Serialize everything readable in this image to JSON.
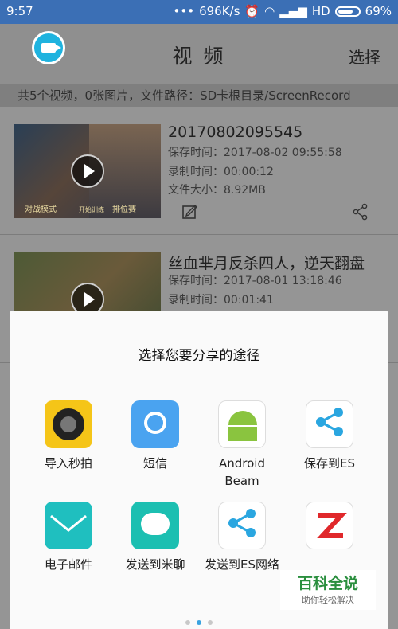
{
  "status": {
    "time": "9:57",
    "speed": "696K/s",
    "network": "HD",
    "battery": "69%"
  },
  "header": {
    "title": "视 频",
    "select_label": "选择"
  },
  "info_bar": "共5个视频，0张图片，文件路径：SD卡根目录/ScreenRecord",
  "videos": [
    {
      "name": "20170802095545",
      "save_time": "保存时间：2017-08-02 09:55:58",
      "record_time": "录制时间：00:00:12",
      "file_size": "文件大小：8.92MB",
      "thumb_left": "对战模式",
      "thumb_mid": "开始训练",
      "thumb_right": "排位赛"
    },
    {
      "name": "丝血芈月反杀四人，逆天翻盘",
      "save_time": "保存时间：2017-08-01 13:18:46",
      "record_time": "录制时间：00:01:41"
    }
  ],
  "share": {
    "title": "选择您要分享的途径",
    "options": [
      {
        "label": "导入秒拍",
        "icon": "miaopai-icon",
        "color": "#f5c518"
      },
      {
        "label": "短信",
        "icon": "sms-icon",
        "color": "#4aa3f0"
      },
      {
        "label": "Android\nBeam",
        "icon": "android-beam-icon",
        "color": "#8ac43f"
      },
      {
        "label": "保存到ES",
        "icon": "es-share-icon",
        "color": "#2aa6e0"
      },
      {
        "label": "电子邮件",
        "icon": "email-icon",
        "color": "#1fbfbf"
      },
      {
        "label": "发送到米聊",
        "icon": "miliao-icon",
        "color": "#1cbfb1"
      },
      {
        "label": "发送到ES网络",
        "icon": "es-network-icon",
        "color": "#2aa6e0"
      },
      {
        "label": "",
        "icon": "zapya-icon",
        "color": "#e0282b"
      }
    ]
  },
  "watermark": {
    "line1": "百科全说",
    "line2": "助你轻松解决"
  }
}
